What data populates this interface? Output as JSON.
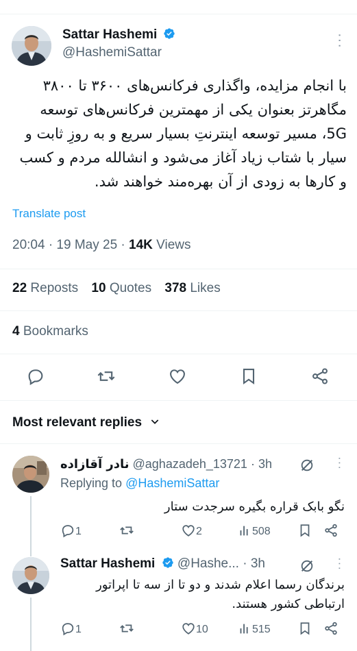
{
  "tweet": {
    "author_name": "Sattar Hashemi",
    "author_handle": "@HashemiSattar",
    "more": "···",
    "text_lines": [
      "با انجام مزایده، واگذاری فرکانس‌های ۳۶۰۰ تا ۳۸۰۰",
      "مگاهرتز بعنوان یکی از مهمترین فرکانس‌های توسعه",
      "5G، مسیر توسعه اینترنتِ بسیار سریع و به روزِ ثابت و",
      "سیار با شتاب زیاد آغاز می‌شود و انشالله مردم و کسب",
      "و کارها به زودی از آن بهره‌مند خواهند شد."
    ],
    "translate": "Translate post",
    "time": "20:04 · 19 May 25 · ",
    "views_count": "14K",
    "views_label": " Views",
    "reposts_count": "22",
    "reposts_label": "Reposts",
    "quotes_count": "10",
    "quotes_label": "Quotes",
    "likes_count": "378",
    "likes_label": "Likes",
    "bookmarks_count": "4",
    "bookmarks_label": "Bookmarks"
  },
  "actions": [
    "reply-icon",
    "repost-icon",
    "like-icon",
    "bookmark-icon",
    "share-icon"
  ],
  "replies_header": "Most relevant replies",
  "replies": [
    {
      "name": "نادر آقازاده",
      "handle": "@aghazadeh_13721",
      "time": "· 3h",
      "replying_prefix": "Replying to ",
      "replying_to": "@HashemiSattar",
      "text_lines": [
        "نگو بابک قراره بگیره سرجدت ستار"
      ],
      "replies": "1",
      "reposts": "",
      "likes": "2",
      "views": "508",
      "more": "···"
    },
    {
      "name": "Sattar Hashemi",
      "handle": "@Hashe...",
      "time": "· 3h",
      "text_lines": [
        "برندگان رسما اعلام شدند و دو تا از سه تا اپراتور",
        "ارتباطی کشور هستند."
      ],
      "replies": "1",
      "reposts": "",
      "likes": "10",
      "views": "515",
      "more": "···"
    }
  ],
  "colors": {
    "link": "#1d9bf0",
    "verified": "#1d9bf0",
    "muted": "#536471",
    "divider": "#eff3f4"
  }
}
